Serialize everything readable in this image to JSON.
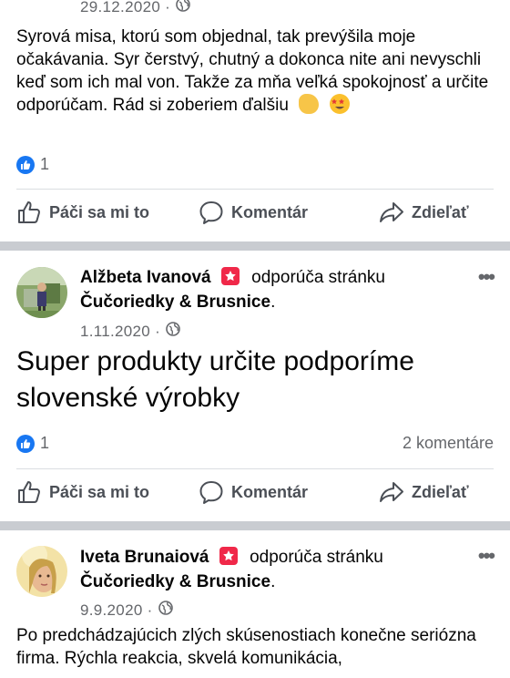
{
  "post1": {
    "date": "29.12.2020 ·",
    "text": "Syrová misa, ktorú som objednal, tak prevýšila moje očakávania. Syr čerstvý, chutný a dokonca nite ani nevyschli keď som ich mal von. Takže za mňa veľká spokojnosť a určite odporúčam. Rád si zoberiem ďalšiu",
    "like_count": "1"
  },
  "post2": {
    "author": "Alžbeta Ivanová",
    "recommends": "odporúča stránku",
    "page": "Čučoriedky & Brusnice",
    "date": "1.11.2020 ·",
    "text": "Super produkty určite podporíme slovenské výrobky",
    "like_count": "1",
    "comments": "2 komentáre"
  },
  "post3": {
    "author": "Iveta Brunaiová",
    "recommends": "odporúča stránku",
    "page": "Čučoriedky & Brusnice",
    "date": "9.9.2020 ·",
    "text": "Po predchádzajúcich zlých skúsenostiach konečne seriózna firma. Rýchla reakcia, skvelá komunikácia,"
  },
  "actions": {
    "like": "Páči sa mi to",
    "comment": "Komentár",
    "share": "Zdieľať"
  },
  "icons": {
    "like": "thumbs-up-icon",
    "comment": "speech-bubble-icon",
    "share": "share-arrow-icon",
    "globe": "globe-icon",
    "more": "more-dots-icon",
    "recommend": "star-badge-icon"
  },
  "colors": {
    "facebook_blue": "#1877f2",
    "recommend_red": "#f02849",
    "separator": "#c9ccd1",
    "muted_text": "#65676b"
  }
}
